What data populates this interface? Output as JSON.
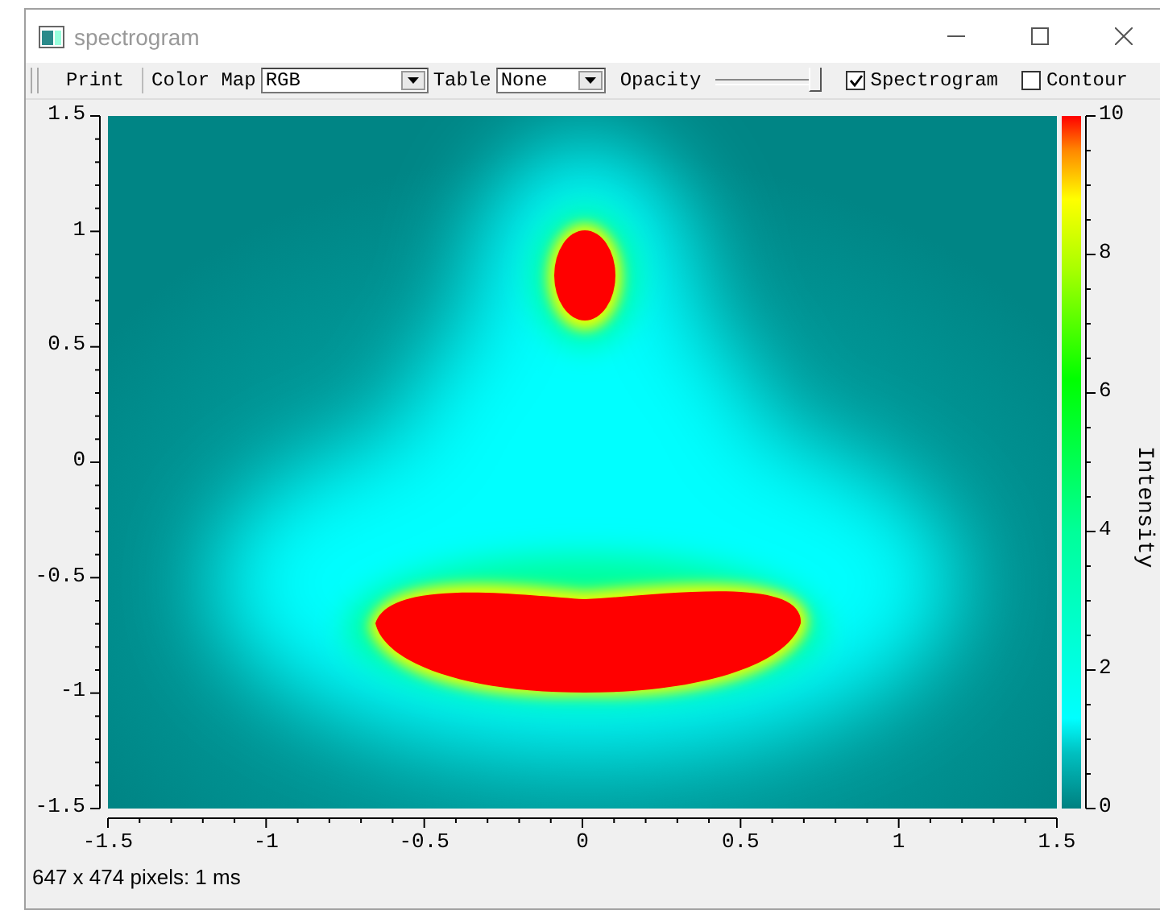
{
  "window": {
    "title": "spectrogram"
  },
  "toolbar": {
    "print_button": "Print",
    "color_map": {
      "label": "Color Map",
      "value": "RGB"
    },
    "table": {
      "label": "Table",
      "value": "None"
    },
    "opacity": {
      "label": "Opacity",
      "level": 1.0
    },
    "checkboxes": [
      {
        "label": "Spectrogram",
        "checked": true
      },
      {
        "label": "Contour",
        "checked": false
      }
    ]
  },
  "plot": {
    "y_axis": {
      "ticks": [
        "1.5",
        "1",
        "0.5",
        "0",
        "-0.5",
        "-1",
        "-1.5"
      ]
    },
    "x_axis": {
      "ticks": [
        "-1.5",
        "-1",
        "-0.5",
        "0",
        "0.5",
        "1",
        "1.5"
      ]
    },
    "color_bar": {
      "title": "Intensity",
      "ticks": [
        "10",
        "8",
        "6",
        "4",
        "2",
        "0"
      ]
    }
  },
  "status_bar": "647 x 474 pixels: 1 ms"
}
